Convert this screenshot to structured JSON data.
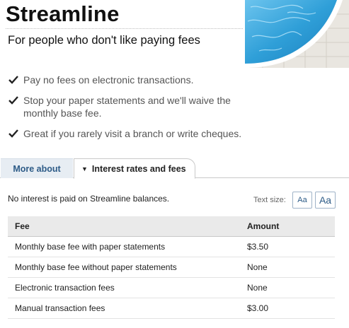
{
  "header": {
    "title": "Streamline",
    "subtitle": "For people who don't like paying fees"
  },
  "features": [
    "Pay no fees on electronic transactions.",
    "Stop your paper statements and we'll waive the monthly base fee.",
    "Great if you rarely visit a branch or write cheques."
  ],
  "tabs": {
    "more_about": "More about",
    "rates_and_fees": "Interest rates and fees"
  },
  "content": {
    "note": "No interest is paid on Streamline balances.",
    "text_size_label": "Text size:",
    "text_size_small": "Aa",
    "text_size_large": "Aa"
  },
  "fees_table": {
    "col_fee": "Fee",
    "col_amount": "Amount",
    "rows": [
      {
        "fee": "Monthly base fee with paper statements",
        "amount": "$3.50"
      },
      {
        "fee": "Monthly base fee without paper statements",
        "amount": "None"
      },
      {
        "fee": "Electronic transaction fees",
        "amount": "None"
      },
      {
        "fee": "Manual transaction fees",
        "amount": "$3.00"
      }
    ]
  },
  "colors": {
    "link_blue": "#2d5b87",
    "tab_bg": "#e7edf3",
    "table_header_bg": "#eaeaea",
    "pool_water": "#3aa6dc"
  },
  "icons": [
    "checkmark-icon",
    "triangle-down-icon"
  ]
}
